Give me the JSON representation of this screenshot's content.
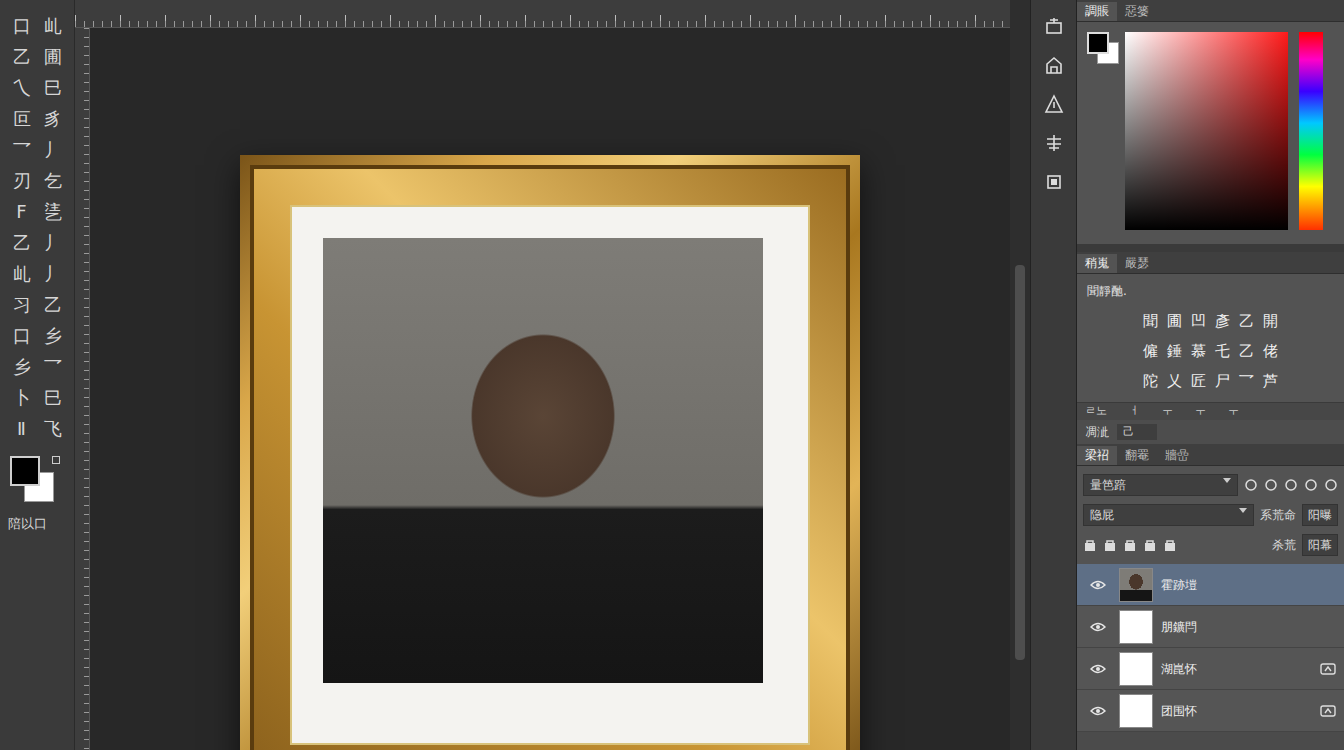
{
  "toolbar": {
    "tools": [
      [
        "口",
        "乢"
      ],
      [
        "乙",
        "圃"
      ],
      [
        "乀",
        "巳"
      ],
      [
        "叵",
        "豸"
      ],
      [
        "乛",
        "丿"
      ],
      [
        "刃",
        "乞"
      ],
      [
        "F",
        "乼"
      ],
      [
        "乙",
        "丿"
      ],
      [
        "乢",
        "丿"
      ],
      [
        "习",
        "乙"
      ],
      [
        "口",
        "乡"
      ],
      [
        "乡",
        "乛"
      ],
      [
        "卜",
        "巳"
      ],
      [
        "Ⅱ",
        "飞"
      ]
    ],
    "label": "陪以口"
  },
  "color_panel": {
    "tabs": [
      {
        "label": "調賬",
        "selected": true
      },
      {
        "label": "惡篓",
        "selected": false
      }
    ]
  },
  "adjustments": {
    "tabs": [
      {
        "label": "稍嵬",
        "selected": true
      },
      {
        "label": "嚴瑟",
        "selected": false
      }
    ],
    "hint": "聞靜酏.",
    "rows": [
      [
        "聞",
        "圃",
        "凹",
        "彥",
        "乙",
        "開"
      ],
      [
        "僱",
        "錘",
        "慕",
        "乇",
        "乙",
        "佬"
      ],
      [
        "陀",
        "乂",
        "匠",
        "尸",
        "乛",
        "芦"
      ]
    ]
  },
  "mini_row": [
    "ㄹ노",
    "ㅓ",
    "ㅜ",
    "ㅜ",
    "ㅜ"
  ],
  "properties": {
    "label": "凋泚",
    "value": "己"
  },
  "layers": {
    "tabs": [
      {
        "label": "梁祒",
        "selected": true
      },
      {
        "label": "翻罨",
        "selected": false
      },
      {
        "label": "牆嵒",
        "selected": false
      }
    ],
    "filter": "量笆踣",
    "blend": "隐屁",
    "opacity_label": "系荒命",
    "opacity": "阳曝",
    "lock_label": "杀荒",
    "fill": "阳幕",
    "items": [
      {
        "name": "霍跡塏",
        "selected": true,
        "visible": true,
        "kind": "photo",
        "linked": false
      },
      {
        "name": "朋鑛閂",
        "selected": false,
        "visible": true,
        "kind": "blank",
        "linked": false
      },
      {
        "name": "湖崑怀",
        "selected": false,
        "visible": true,
        "kind": "blank",
        "linked": true
      },
      {
        "name": "团围怀",
        "selected": false,
        "visible": true,
        "kind": "blank",
        "linked": true
      }
    ]
  }
}
